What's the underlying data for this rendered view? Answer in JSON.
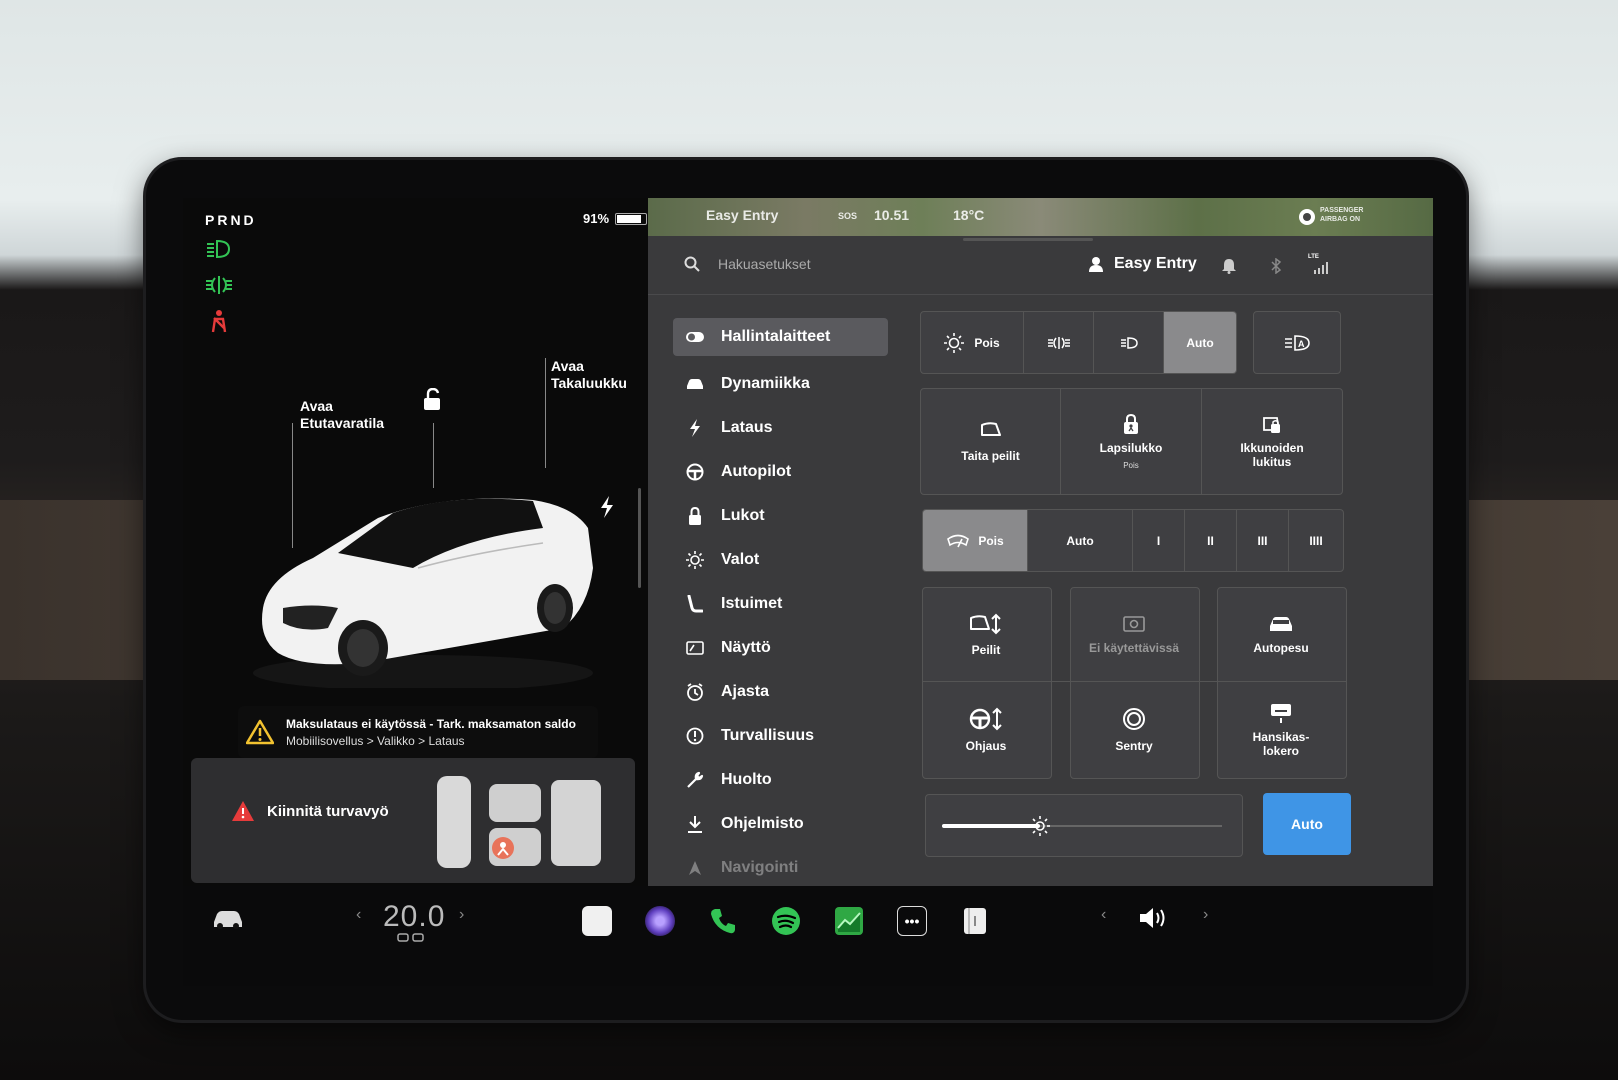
{
  "status": {
    "gear": "PRND",
    "battery_percent": "91%",
    "battery_level": 0.91
  },
  "car_view": {
    "frunk_label_1": "Avaa",
    "frunk_label_2": "Etutavaratila",
    "trunk_label_1": "Avaa",
    "trunk_label_2": "Takaluukku"
  },
  "alert": {
    "title": "Maksulataus ei käytössä - Tark. maksamaton saldo",
    "path": "Mobiilisovellus > Valikko > Lataus"
  },
  "seatbelt_card": {
    "message": "Kiinnitä turvavyö"
  },
  "map_strip": {
    "profile": "Easy Entry",
    "sos": "SOS",
    "time": "10.51",
    "temp": "18°C",
    "airbag": "PASSENGER AIRBAG ON"
  },
  "topbar": {
    "search_placeholder": "Hakuasetukset",
    "profile_name": "Easy Entry",
    "lte": "LTE"
  },
  "menu": [
    {
      "label": "Hallintalaitteet",
      "icon": "toggle-icon",
      "active": true
    },
    {
      "label": "Dynamiikka",
      "icon": "car-icon"
    },
    {
      "label": "Lataus",
      "icon": "bolt-icon"
    },
    {
      "label": "Autopilot",
      "icon": "steering-wheel-icon"
    },
    {
      "label": "Lukot",
      "icon": "lock-icon"
    },
    {
      "label": "Valot",
      "icon": "sun-icon"
    },
    {
      "label": "Istuimet",
      "icon": "seat-icon"
    },
    {
      "label": "Näyttö",
      "icon": "display-icon"
    },
    {
      "label": "Ajasta",
      "icon": "clock-icon"
    },
    {
      "label": "Turvallisuus",
      "icon": "info-icon"
    },
    {
      "label": "Huolto",
      "icon": "wrench-icon"
    },
    {
      "label": "Ohjelmisto",
      "icon": "download-icon"
    },
    {
      "label": "Navigointi",
      "icon": "navigation-icon"
    }
  ],
  "lights": {
    "off_label": "Pois",
    "auto_label": "Auto",
    "selected": "Auto"
  },
  "locks_row": {
    "fold_mirrors": "Taita peilit",
    "child_lock": "Lapsilukko",
    "child_lock_state": "Pois",
    "window_lock_1": "Ikkunoiden",
    "window_lock_2": "lukitus"
  },
  "wipers": {
    "off_label": "Pois",
    "auto_label": "Auto",
    "levels": [
      "I",
      "II",
      "III",
      "IIII"
    ],
    "selected": "Pois"
  },
  "tiles": {
    "mirrors": "Peilit",
    "unavailable": "Ei käytettävissä",
    "car_wash": "Autopesu",
    "steering": "Ohjaus",
    "sentry": "Sentry",
    "glovebox_1": "Hansikas-",
    "glovebox_2": "lokero"
  },
  "brightness": {
    "level": 0.35,
    "auto_label": "Auto"
  },
  "dock": {
    "temperature": "20.0"
  },
  "colors": {
    "accent_blue": "#3f95e6",
    "indicator_green": "#33c455",
    "indicator_red": "#e63b3b",
    "warning_yellow": "#f2c230"
  }
}
